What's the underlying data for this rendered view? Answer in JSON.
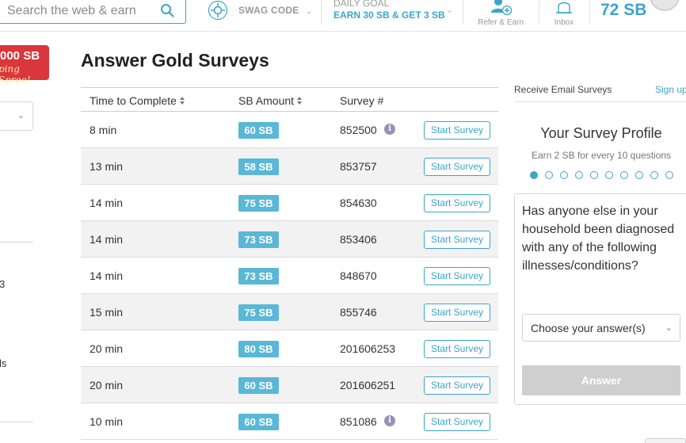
{
  "header": {
    "search_placeholder": "Search the web & earn",
    "swag_code_label": "SWAG CODE",
    "daily_goal_title": "DAILY GOAL",
    "daily_goal_text": "EARN 30 SB & GET 3 SB",
    "refer_label": "Refer & Earn",
    "inbox_label": "Inbox",
    "balance": "72 SB"
  },
  "left": {
    "promo_amount": "000 SB",
    "promo_sub": "ping Spree!",
    "frag_1": "3",
    "frag_2": "ls"
  },
  "main": {
    "title": "Answer Gold Surveys",
    "columns": [
      "Time to Complete",
      "SB Amount",
      "Survey #"
    ],
    "start_label": "Start Survey",
    "rows": [
      {
        "time": "8 min",
        "sb": "60 SB",
        "survey": "852500",
        "info": true
      },
      {
        "time": "13 min",
        "sb": "58 SB",
        "survey": "853757",
        "info": false
      },
      {
        "time": "14 min",
        "sb": "75 SB",
        "survey": "854630",
        "info": false
      },
      {
        "time": "14 min",
        "sb": "73 SB",
        "survey": "853406",
        "info": false
      },
      {
        "time": "14 min",
        "sb": "73 SB",
        "survey": "848670",
        "info": false
      },
      {
        "time": "15 min",
        "sb": "75 SB",
        "survey": "855746",
        "info": false
      },
      {
        "time": "20 min",
        "sb": "80 SB",
        "survey": "201606253",
        "info": false
      },
      {
        "time": "20 min",
        "sb": "60 SB",
        "survey": "201606251",
        "info": false
      },
      {
        "time": "10 min",
        "sb": "60 SB",
        "survey": "851086",
        "info": true
      }
    ]
  },
  "right": {
    "email_label": "Receive Email Surveys",
    "signup_label": "Sign up",
    "profile_title": "Your Survey Profile",
    "profile_sub": "Earn 2 SB for every 10 questions",
    "progress_total": 10,
    "progress_current": 1,
    "question": "Has anyone else in your household been diagnosed with any of the following illnesses/conditions?",
    "select_value": "Choose your answer(s)",
    "answer_button": "Answer"
  },
  "colors": {
    "accent": "#3ba5c9",
    "badge": "#5bb7d6",
    "promo": "#d9363e"
  },
  "icons": {
    "search": "search-icon",
    "swag": "swag-code-icon",
    "refer": "refer-user-icon",
    "inbox": "inbox-bell-icon",
    "info": "info-icon"
  }
}
